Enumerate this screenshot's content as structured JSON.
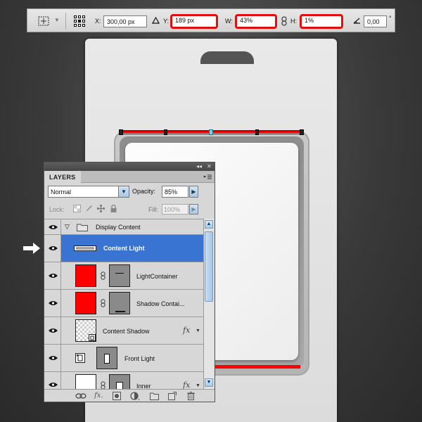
{
  "options_bar": {
    "x_label": "X:",
    "x_value": "300,00 px",
    "y_label": "Y:",
    "y_value": "189 px",
    "w_label": "W:",
    "w_value": "43%",
    "h_label": "H:",
    "h_value": "1%",
    "angle_value": "0,00",
    "degree_symbol": "°",
    "highlight_color": "#e01010"
  },
  "layers_panel": {
    "tab_label": "LAYERS",
    "blend_mode": "Normal",
    "opacity_label": "Opacity:",
    "opacity_value": "85%",
    "lock_label": "Lock:",
    "fill_label": "Fill:",
    "fill_value": "100%",
    "selected_color": "#3a74d3",
    "layers": [
      {
        "name": "Display Content",
        "type": "group",
        "selected": false
      },
      {
        "name": "Content Light",
        "type": "shape",
        "selected": true
      },
      {
        "name": "LightContainer",
        "type": "mask",
        "selected": false
      },
      {
        "name": "Shadow Contai...",
        "type": "mask",
        "selected": false
      },
      {
        "name": "Content Shadow",
        "type": "fx",
        "selected": false,
        "fx": "fx"
      },
      {
        "name": "Front Light",
        "type": "smart",
        "selected": false
      },
      {
        "name": "Inner",
        "type": "fx",
        "selected": false,
        "fx": "fx"
      }
    ]
  },
  "colors": {
    "accent_red": "#ff0000",
    "background": "#3a3a3a"
  }
}
